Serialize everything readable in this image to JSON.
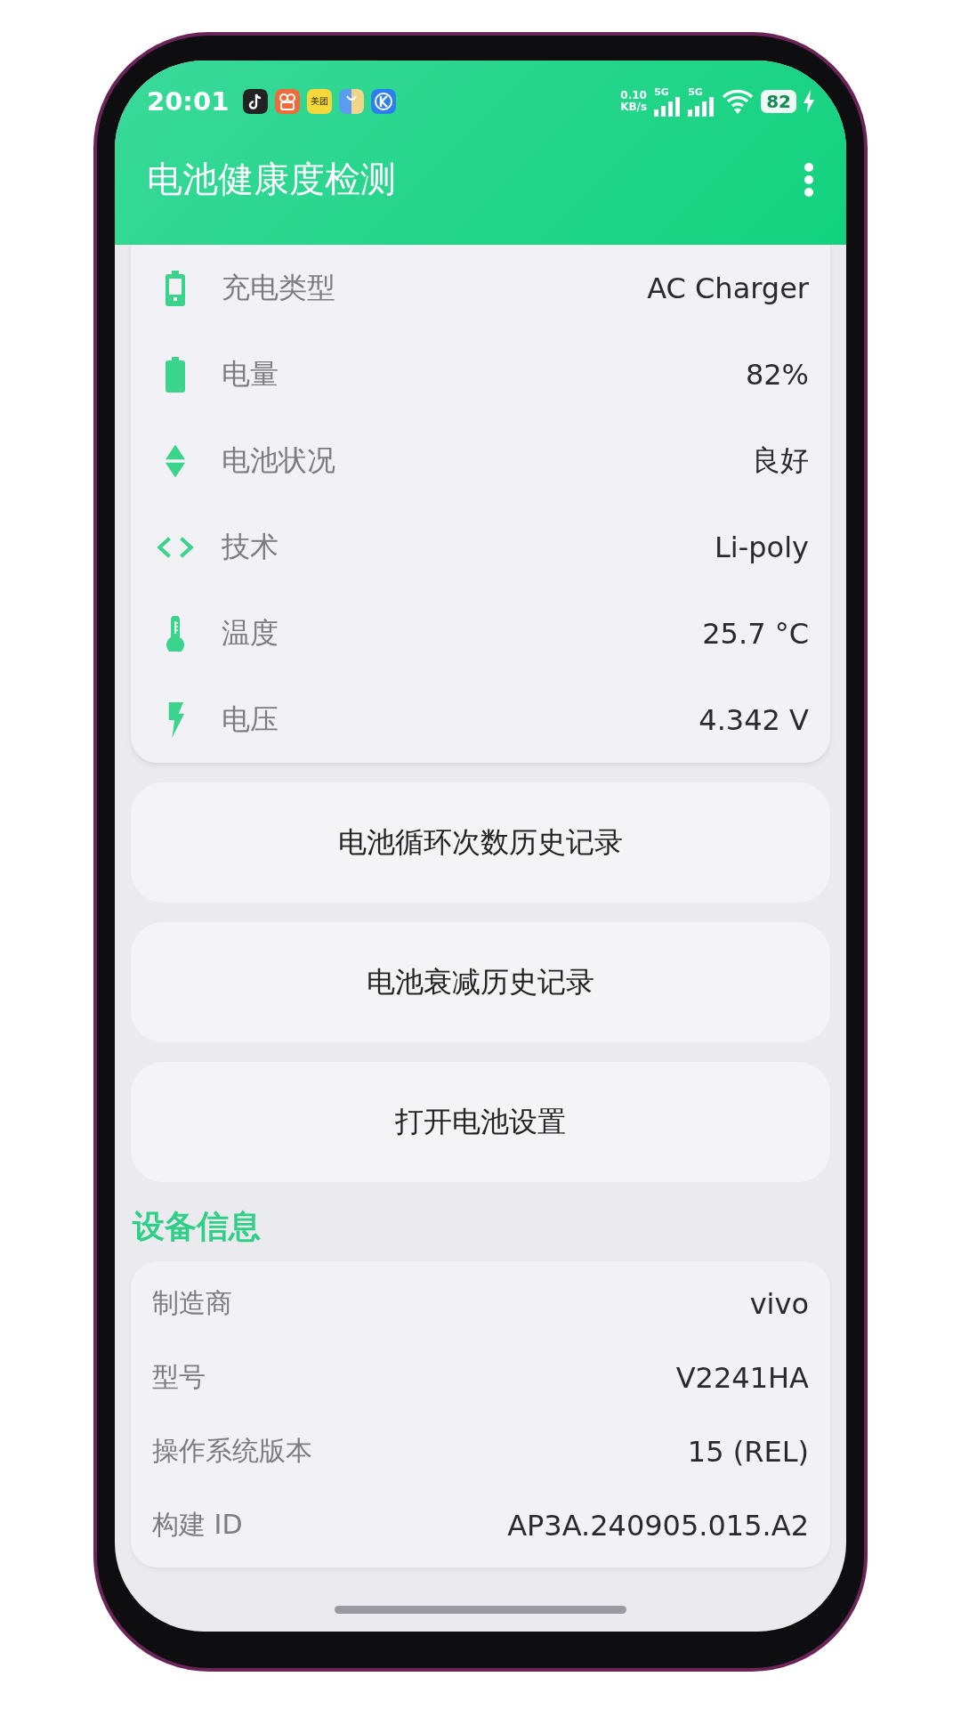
{
  "status_bar": {
    "time": "20:01",
    "notification_label": "美团",
    "net_speed": "0.10",
    "net_unit": "KB/s",
    "signals": [
      {
        "label": "5G"
      },
      {
        "label": "5G"
      }
    ],
    "battery": "82"
  },
  "app_bar": {
    "title": "电池健康度检测"
  },
  "battery_info": [
    {
      "kind": "charger",
      "label": "充电类型",
      "value": "AC Charger"
    },
    {
      "kind": "battery",
      "label": "电量",
      "value": "82%"
    },
    {
      "kind": "health",
      "label": "电池状况",
      "value": "良好"
    },
    {
      "kind": "technology",
      "label": "技术",
      "value": "Li-poly"
    },
    {
      "kind": "temperature",
      "label": "温度",
      "value": "25.7 °C"
    },
    {
      "kind": "voltage",
      "label": "电压",
      "value": "4.342 V"
    }
  ],
  "buttons": [
    "电池循环次数历史记录",
    "电池衰减历史记录",
    "打开电池设置"
  ],
  "device_info": {
    "title": "设备信息",
    "rows": [
      {
        "label": "制造商",
        "value": "vivo"
      },
      {
        "label": "型号",
        "value": "V2241HA"
      },
      {
        "label": "操作系统版本",
        "value": "15 (REL)"
      },
      {
        "label": "构建 ID",
        "value": "AP3A.240905.015.A2"
      }
    ]
  }
}
